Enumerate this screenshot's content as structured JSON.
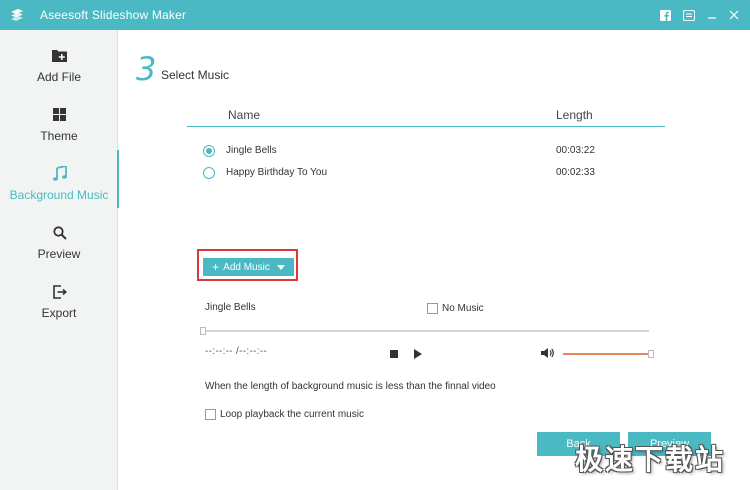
{
  "app": {
    "title": "Aseesoft Slideshow Maker"
  },
  "colors": {
    "accent": "#4ab9c3",
    "highlight_outline": "#d9393b",
    "volume": "#e6845a"
  },
  "sidebar": {
    "items": [
      {
        "label": "Add File",
        "icon": "add-folder-icon"
      },
      {
        "label": "Theme",
        "icon": "theme-grid-icon"
      },
      {
        "label": "Background Music",
        "icon": "music-note-icon",
        "active": true
      },
      {
        "label": "Preview",
        "icon": "magnifier-icon"
      },
      {
        "label": "Export",
        "icon": "export-icon"
      }
    ]
  },
  "step": {
    "number": "3",
    "title": "Select Music"
  },
  "table": {
    "headers": {
      "name": "Name",
      "length": "Length"
    },
    "rows": [
      {
        "name": "Jingle Bells",
        "length": "00:03:22",
        "selected": true
      },
      {
        "name": "Happy Birthday To You",
        "length": "00:02:33",
        "selected": false
      }
    ]
  },
  "add_music": {
    "label": "Add Music"
  },
  "player": {
    "current_track": "Jingle Bells",
    "no_music_label": "No Music",
    "no_music_checked": false,
    "time": "--:--:-- /--:--:--",
    "progress": 0,
    "volume": 1.0
  },
  "options": {
    "note": "When the length of background music is less than the finnal video",
    "loop_label": "Loop playback the current music",
    "loop_checked": false
  },
  "buttons": {
    "back": "Back",
    "preview": "Preview"
  },
  "watermark": "极速下载站"
}
